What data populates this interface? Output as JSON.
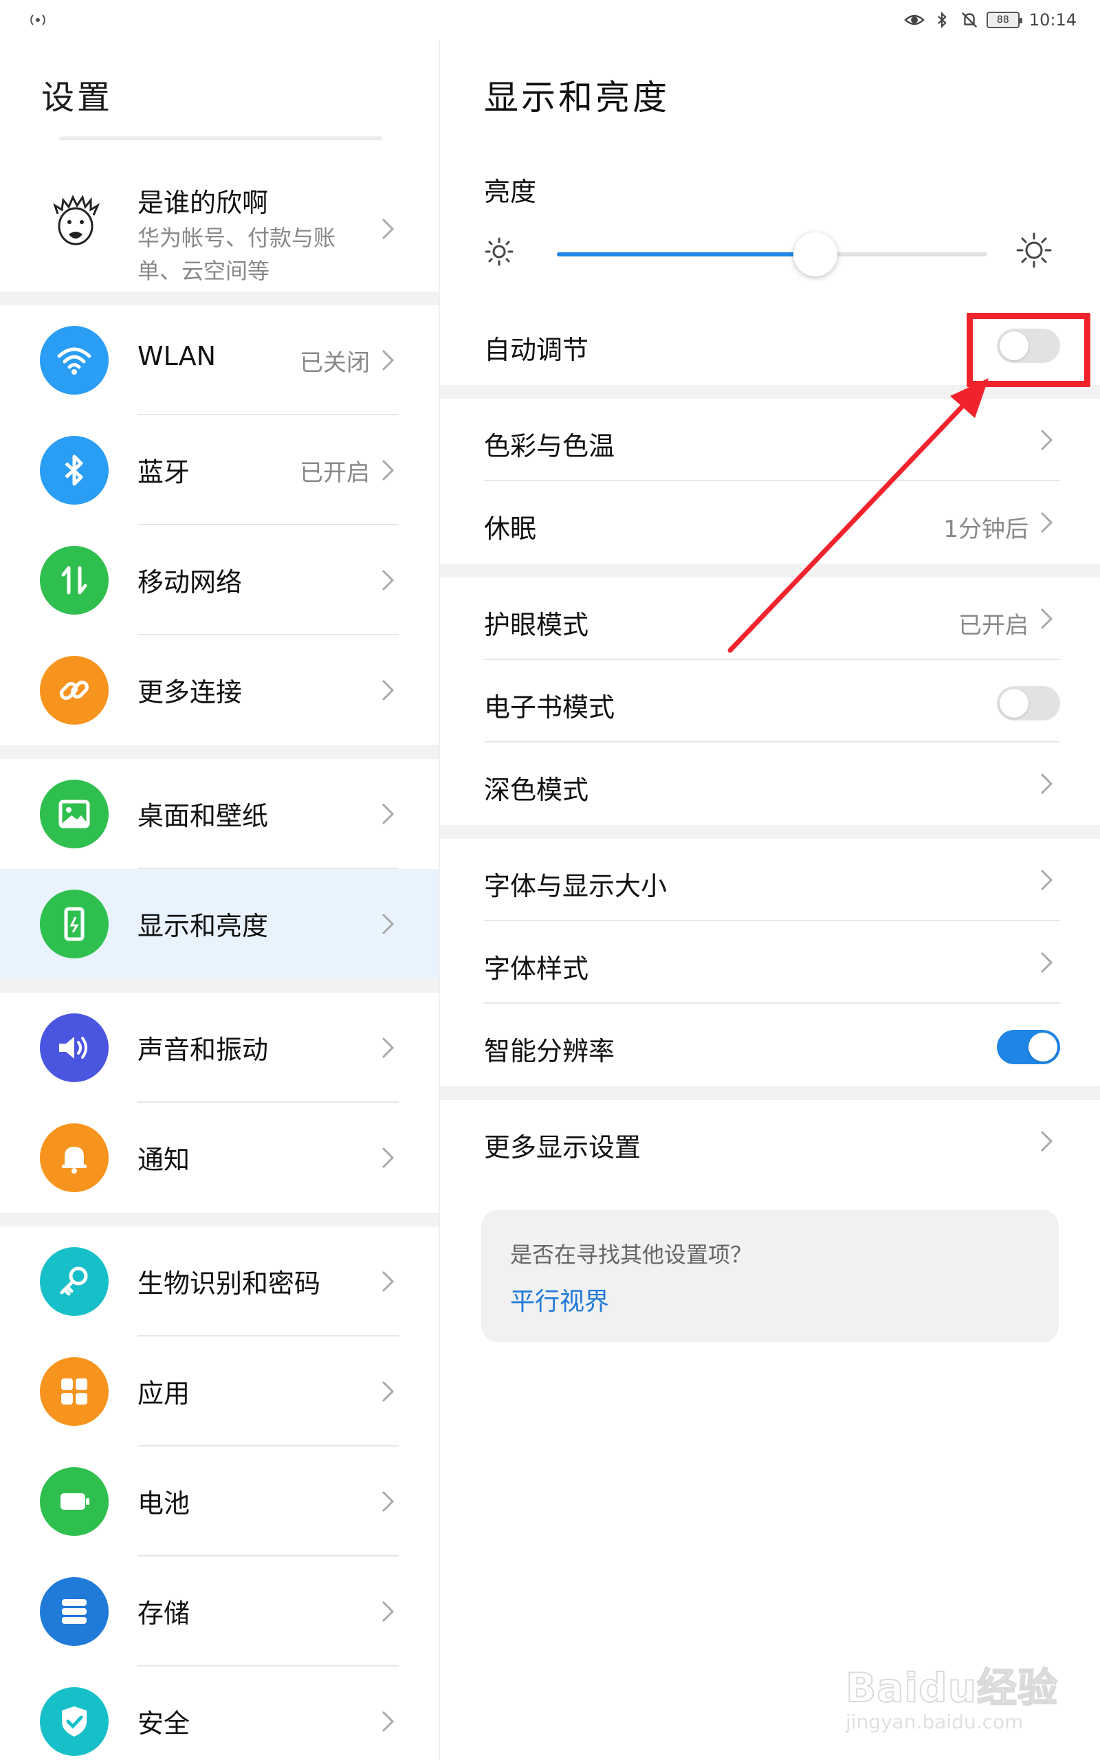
{
  "status_bar": {
    "time": "10:14",
    "battery": "88",
    "icons": [
      "hotspot-icon",
      "eye-comfort-icon",
      "bluetooth-icon",
      "mute-icon",
      "battery-icon"
    ]
  },
  "left_panel": {
    "title": "设置",
    "account": {
      "name": "是谁的欣啊",
      "subtitle": "华为帐号、付款与账单、云空间等"
    },
    "items": [
      {
        "label": "WLAN",
        "value": "已关闭",
        "icon": "wifi-icon",
        "color": "#2a9df4"
      },
      {
        "label": "蓝牙",
        "value": "已开启",
        "icon": "bluetooth-icon",
        "color": "#2a9df4"
      },
      {
        "label": "移动网络",
        "value": "",
        "icon": "mobile-data-icon",
        "color": "#2fbf4f"
      },
      {
        "label": "更多连接",
        "value": "",
        "icon": "link-icon",
        "color": "#f7941d"
      },
      {
        "label": "桌面和壁纸",
        "value": "",
        "icon": "wallpaper-icon",
        "color": "#2fbf4f"
      },
      {
        "label": "显示和亮度",
        "value": "",
        "icon": "display-icon",
        "color": "#2fbf4f"
      },
      {
        "label": "声音和振动",
        "value": "",
        "icon": "sound-icon",
        "color": "#4a55e0"
      },
      {
        "label": "通知",
        "value": "",
        "icon": "bell-icon",
        "color": "#f7941d"
      },
      {
        "label": "生物识别和密码",
        "value": "",
        "icon": "key-icon",
        "color": "#17c0c8"
      },
      {
        "label": "应用",
        "value": "",
        "icon": "apps-icon",
        "color": "#f7941d"
      },
      {
        "label": "电池",
        "value": "",
        "icon": "battery-icon",
        "color": "#2fbf4f"
      },
      {
        "label": "存储",
        "value": "",
        "icon": "storage-icon",
        "color": "#1f7ad8"
      },
      {
        "label": "安全",
        "value": "",
        "icon": "shield-icon",
        "color": "#17c0c8"
      }
    ]
  },
  "right_panel": {
    "title": "显示和亮度",
    "brightness_label": "亮度",
    "brightness_level": 0.6,
    "auto_adjust": {
      "label": "自动调节",
      "on": false
    },
    "rows": {
      "color_temp": {
        "label": "色彩与色温"
      },
      "sleep": {
        "label": "休眠",
        "value": "1分钟后"
      },
      "eye_comfort": {
        "label": "护眼模式",
        "value": "已开启"
      },
      "ebook": {
        "label": "电子书模式",
        "on": false
      },
      "dark": {
        "label": "深色模式"
      },
      "font_size": {
        "label": "字体与显示大小"
      },
      "font_style": {
        "label": "字体样式"
      },
      "smart_resolution": {
        "label": "智能分辨率",
        "on": true
      },
      "more_display": {
        "label": "更多显示设置"
      }
    },
    "suggestion": {
      "question": "是否在寻找其他设置项？",
      "link": "平行视界"
    }
  },
  "annotation": {
    "color": "#f0232d"
  },
  "watermark": {
    "main": "Baidu经验",
    "sub": "jingyan.baidu.com"
  },
  "colors": {
    "accent": "#1f86e6",
    "selected_bg": "#e8f3fd"
  }
}
